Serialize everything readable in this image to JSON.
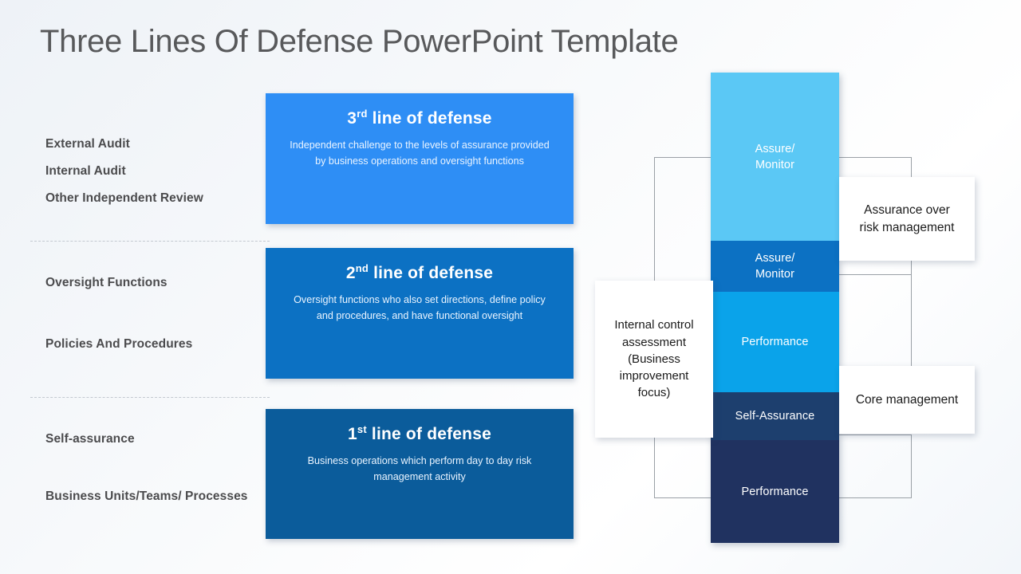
{
  "slide": {
    "title": "Three Lines Of Defense PowerPoint Template",
    "background_color": "#f3f6fa"
  },
  "left_labels": {
    "group_third_line": [
      {
        "text": "External Audit"
      },
      {
        "text": "Internal Audit"
      },
      {
        "text": "Other Independent Review"
      }
    ],
    "group_second_line": [
      {
        "text": "Oversight Functions"
      },
      {
        "text": "Policies And Procedures"
      }
    ],
    "group_first_line": [
      {
        "text": "Self-assurance"
      },
      {
        "text": "Business Units/Teams/ Processes"
      }
    ]
  },
  "defense_lines": [
    {
      "id": "third",
      "ordinal_number": "3",
      "ordinal_suffix": "rd",
      "title_rest": " line of defense",
      "description": "Independent challenge to the levels of assurance provided by business operations and oversight functions",
      "color": "#2e8ef5"
    },
    {
      "id": "second",
      "ordinal_number": "2",
      "ordinal_suffix": "nd",
      "title_rest": " line of defense",
      "description": "Oversight functions who also set directions, define policy and procedures, and have functional oversight",
      "color": "#0c71c3"
    },
    {
      "id": "first",
      "ordinal_number": "1",
      "ordinal_suffix": "st",
      "title_rest": " line of defense",
      "description": "Business operations which perform day to day risk management activity",
      "color": "#0b5c9b"
    }
  ],
  "stack_column": {
    "segments": [
      {
        "label": "Assure/\nMonitor",
        "color": "#5bc8f5"
      },
      {
        "label": "Assure/\nMonitor",
        "color": "#0c71c3"
      },
      {
        "label": "Performance",
        "color": "#0aa3ea"
      },
      {
        "label": "Self-Assurance",
        "color": "#1d3f6e"
      },
      {
        "label": "Performance",
        "color": "#203260"
      }
    ]
  },
  "callouts": {
    "internal_control": "Internal control assessment (Business improvement focus)",
    "assurance_over_risk": "Assurance over\nrisk management",
    "core_management": "Core management"
  }
}
